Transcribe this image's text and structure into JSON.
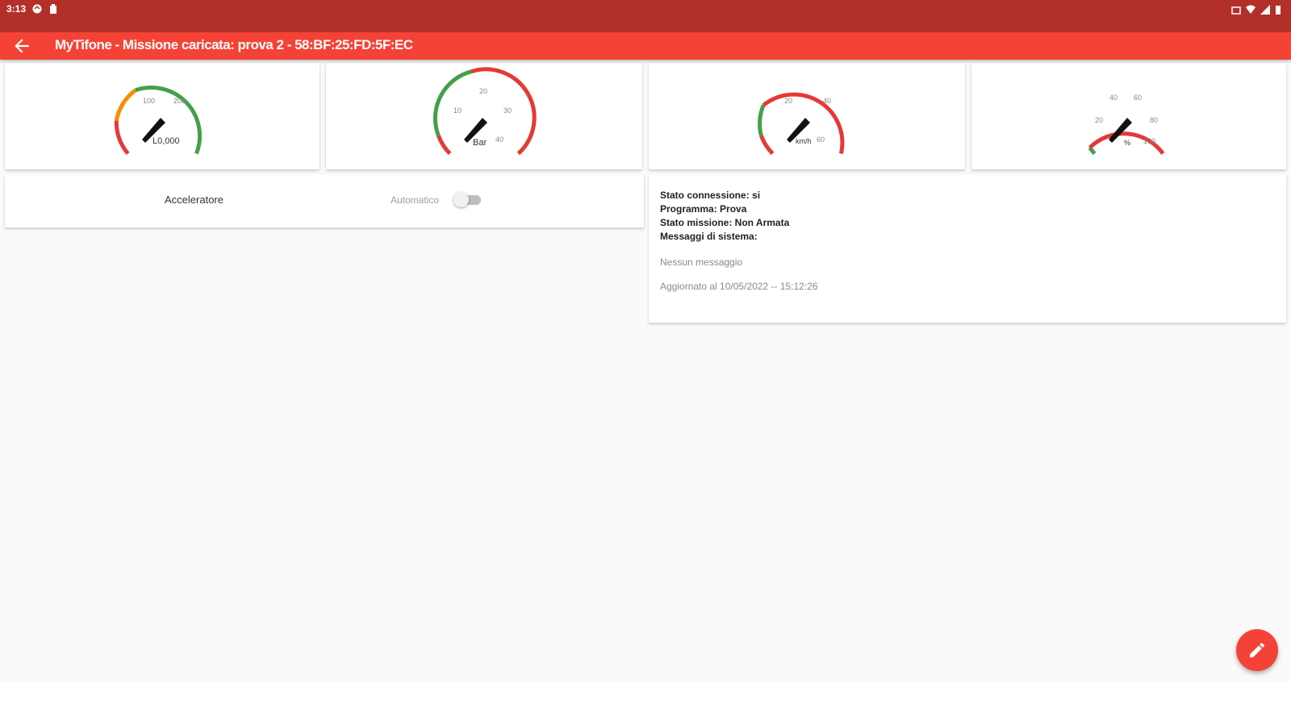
{
  "status_bar": {
    "time": "3:13",
    "icons_left": [
      "sync-icon",
      "clipboard-icon"
    ],
    "icons_right": [
      "battery-saver-icon",
      "wifi-icon",
      "signal-icon",
      "battery-icon"
    ]
  },
  "app_bar": {
    "title": "MyTifone - Missione caricata: prova 2 - 58:BF:25:FD:5F:EC",
    "back_icon": "arrow-back-icon",
    "background": "#f44336",
    "status_bar_color": "#b3302a"
  },
  "gauges": [
    {
      "ticks": [
        "100",
        "200"
      ],
      "unit": "L0,000",
      "value_label": "",
      "arc_colors": [
        "red",
        "orange",
        "green"
      ]
    },
    {
      "ticks": [
        "10",
        "20",
        "30",
        "40"
      ],
      "unit": "Bar",
      "value_label": "",
      "arc_colors": [
        "red",
        "green",
        "red"
      ]
    },
    {
      "ticks": [
        "20",
        "40",
        "60"
      ],
      "unit": "km/h",
      "value_label": "",
      "arc_colors": [
        "red",
        "green",
        "red"
      ]
    },
    {
      "ticks": [
        "20",
        "40",
        "60",
        "80",
        "100"
      ],
      "unit": "%",
      "value_label": "",
      "arc_colors": [
        "red",
        "green",
        "red"
      ]
    }
  ],
  "controls": {
    "accelerator_label": "Acceleratore",
    "auto_label": "Automatico",
    "auto_enabled": false
  },
  "info": {
    "lines": [
      "Stato connessione: si",
      "Programma: Prova",
      "Stato missione: Non Armata",
      "Messaggi di sistema:"
    ],
    "message": "Nessun messaggio",
    "updated": "Aggiornato al 10/05/2022 -- 15:12:26"
  },
  "fab": {
    "icon": "pencil-icon",
    "color": "#f44336"
  },
  "colors": {
    "red": "#e53935",
    "green": "#43a047",
    "orange": "#fb8c00"
  }
}
